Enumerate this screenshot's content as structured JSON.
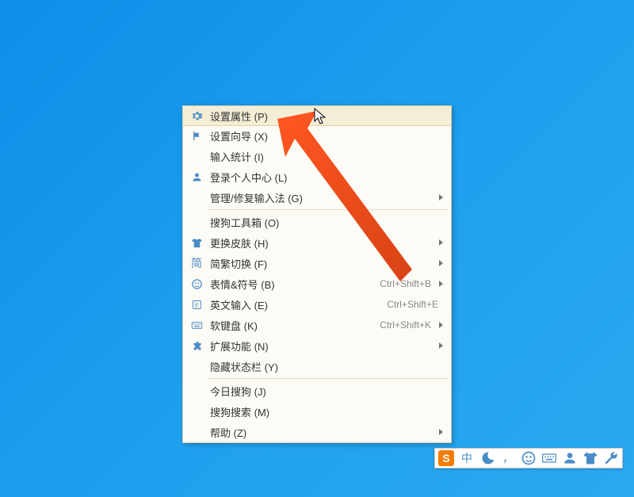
{
  "menu": {
    "items": [
      {
        "icon": "gear",
        "label": "设置属性 (P)",
        "highlighted": true
      },
      {
        "icon": "flag",
        "label": "设置向导 (X)"
      },
      {
        "icon": "",
        "label": "输入统计 (I)"
      },
      {
        "icon": "user",
        "label": "登录个人中心 (L)"
      },
      {
        "icon": "",
        "label": "管理/修复输入法 (G)",
        "submenu": true
      },
      {
        "separator": true
      },
      {
        "icon": "",
        "label": "搜狗工具箱 (O)"
      },
      {
        "icon": "shirt",
        "label": "更换皮肤 (H)",
        "submenu": true
      },
      {
        "icon": "simp",
        "label": "简繁切换 (F)",
        "submenu": true
      },
      {
        "icon": "smiley",
        "label": "表情&符号 (B)",
        "shortcut": "Ctrl+Shift+B",
        "submenu": true
      },
      {
        "icon": "e",
        "label": "英文输入 (E)",
        "shortcut": "Ctrl+Shift+E"
      },
      {
        "icon": "keyboard",
        "label": "软键盘 (K)",
        "shortcut": "Ctrl+Shift+K",
        "submenu": true
      },
      {
        "icon": "puzzle",
        "label": "扩展功能 (N)",
        "submenu": true
      },
      {
        "icon": "",
        "label": "隐藏状态栏 (Y)"
      },
      {
        "separator": true
      },
      {
        "icon": "",
        "label": "今日搜狗 (J)"
      },
      {
        "icon": "",
        "label": "搜狗搜索 (M)"
      },
      {
        "icon": "",
        "label": "帮助 (Z)",
        "submenu": true
      }
    ]
  },
  "statusbar": {
    "items": [
      {
        "icon": "logo",
        "name": "sogou-logo"
      },
      {
        "text": "中",
        "name": "cn-indicator"
      },
      {
        "icon": "moon",
        "name": "moon-icon"
      },
      {
        "text": "，",
        "name": "punct-indicator"
      },
      {
        "icon": "smiley",
        "name": "emoji-icon"
      },
      {
        "icon": "keyboard",
        "name": "keyboard-icon"
      },
      {
        "icon": "user",
        "name": "user-icon"
      },
      {
        "icon": "shirt",
        "name": "skin-icon"
      },
      {
        "icon": "wrench",
        "name": "wrench-icon"
      }
    ]
  },
  "icons": {
    "simp_char": "简"
  }
}
